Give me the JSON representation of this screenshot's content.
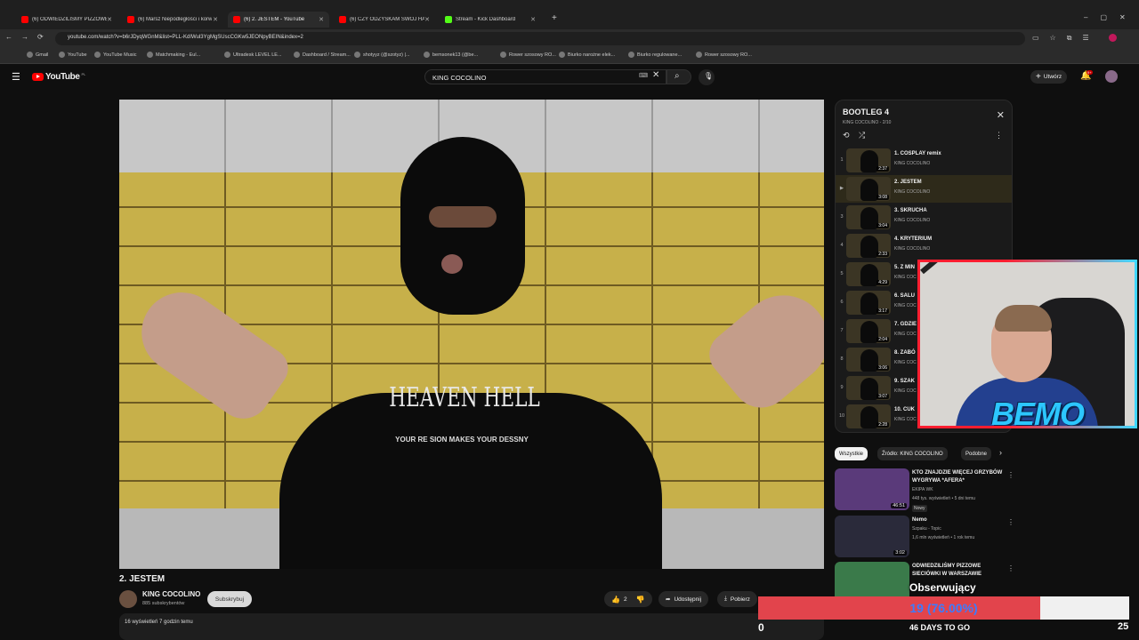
{
  "browser": {
    "tabs": [
      {
        "label": "(6) ODWIEDZILIŚMY PIZZOWE",
        "kind": "youtube"
      },
      {
        "label": "(6) Marsz Niepodległości i korw",
        "kind": "youtube"
      },
      {
        "label": "(6) 2. JESTEM - YouTube",
        "kind": "youtube",
        "active": true
      },
      {
        "label": "(6) CZY ODZYSKAM SWÓJ HA",
        "kind": "youtube"
      },
      {
        "label": "Stream - Kick Dashboard",
        "kind": "kick"
      }
    ],
    "url": "youtube.com/watch?v=b6rJDyqWGnM&list=PLL-KdIWul3YgMgSUscCGKw5JEONpyBEIN&index=2",
    "bookmarks": [
      "Gmail",
      "YouTube",
      "YouTube Music",
      "Matchmaking - Eul...",
      "Ultradesk LEVEL LE...",
      "Dashboard / Stream...",
      "shotyyz (@szotyz) |...",
      "bemsonek13 (@be...",
      "Rower szosowy RO...",
      "Biurko narożne elek...",
      "Biurko regulowane...",
      "Rower szosowy RO..."
    ]
  },
  "youtube": {
    "logo": "YouTube",
    "region": "PL",
    "search_value": "KING COCOLINO",
    "create_label": "Utwórz",
    "notif_count": "9+"
  },
  "video": {
    "shirt_text": "HEAVEN HELL",
    "shirt_sub": "YOUR RE SION MAKES YOUR DESSNY",
    "title": "2. JESTEM",
    "channel": "KING COCOLINO",
    "subscribers": "885 subskrybentów",
    "subscribe_label": "Subskrybuj",
    "likes": "2",
    "share_label": "Udostępnij",
    "download_label": "Pobierz",
    "meta": "16 wyświetleń  7 godzin temu"
  },
  "playlist": {
    "title": "BOOTLEG 4",
    "subtitle": "KING COCOLINO - 2/10",
    "items": [
      {
        "idx": "1",
        "name": "1. COSPLAY remix",
        "channel": "KING COCOLINO",
        "duration": "2:37"
      },
      {
        "idx": "▶",
        "name": "2. JESTEM",
        "channel": "KING COCOLINO",
        "duration": "3:08"
      },
      {
        "idx": "3",
        "name": "3. SKRUCHA",
        "channel": "KING COCOLINO",
        "duration": "3:04"
      },
      {
        "idx": "4",
        "name": "4. KRYTERIUM",
        "channel": "KING COCOLINO",
        "duration": "2:33"
      },
      {
        "idx": "5",
        "name": "5. Z MIN",
        "channel": "KING COC",
        "duration": "4:29"
      },
      {
        "idx": "6",
        "name": "6. SALU",
        "channel": "KING COC",
        "duration": "3:17"
      },
      {
        "idx": "7",
        "name": "7. GDZIE",
        "channel": "KING COC",
        "duration": "2:04"
      },
      {
        "idx": "8",
        "name": "8. ZABÓ",
        "channel": "KING COC",
        "duration": "3:06"
      },
      {
        "idx": "9",
        "name": "9. SZAK",
        "channel": "KING COC",
        "duration": "3:07"
      },
      {
        "idx": "10",
        "name": "10. CUK",
        "channel": "KING COC",
        "duration": "2:28"
      }
    ]
  },
  "chips": [
    "Wszystkie",
    "Źródło: KING COCOLINO",
    "Podobne"
  ],
  "recommended": [
    {
      "title": "KTO ZNAJDZIE WIĘCEJ GRZYBÓW WYGRYWA *AFERA*",
      "channel": "EKIPA WK",
      "stats": "448 tys. wyświetleń • 5 dni temu",
      "badge": "Nowy",
      "duration": "46:51",
      "color": "#5a3a7a"
    },
    {
      "title": "Nemo",
      "channel": "Szpaku - Topic",
      "stats": "1,6 mln wyświetleń • 1 rok temu",
      "badge": "",
      "duration": "3:02",
      "color": "#2a2a3a"
    },
    {
      "title": "ODWIEDZILIŚMY PIZZOWE SIECIÓWKI W WARSZAWIE",
      "channel": "",
      "stats": "",
      "badge": "",
      "duration": "",
      "color": "#3a7a4a"
    }
  ],
  "overlay": {
    "cam_name": "BEMO",
    "goal_label": "Obserwujący",
    "goal_text": "19 (76.00%)",
    "goal_fraction": 0.76,
    "goal_min": "0",
    "goal_days": "46 DAYS TO GO",
    "goal_max": "25"
  }
}
